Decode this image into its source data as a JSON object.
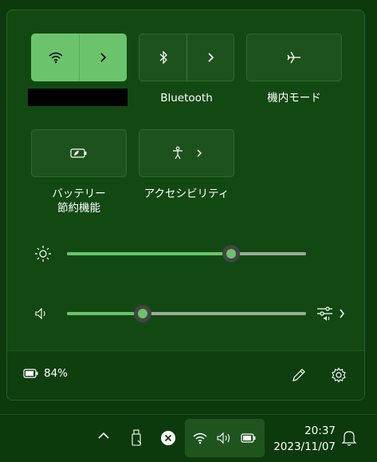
{
  "quick_settings": {
    "tiles": [
      {
        "id": "wifi",
        "label": "",
        "state": "on",
        "icon": "wifi-icon"
      },
      {
        "id": "bluetooth",
        "label": "Bluetooth",
        "state": "off",
        "icon": "bluetooth-icon"
      },
      {
        "id": "airplane",
        "label": "機内モード",
        "state": "off",
        "icon": "airplane-icon"
      },
      {
        "id": "battery_saver",
        "label_line1": "バッテリー",
        "label_line2": "節約機能",
        "state": "off",
        "icon": "battery-saver-icon"
      },
      {
        "id": "accessibility",
        "label": "アクセシビリティ",
        "state": "off",
        "icon": "accessibility-icon"
      }
    ],
    "brightness_level": 0.69,
    "volume_level": 0.31,
    "battery_text": "84%"
  },
  "taskbar": {
    "time": "20:37",
    "date": "2023/11/07"
  },
  "colors": {
    "accent": "#6bc46b",
    "panel_bg": "#124912",
    "tile_off": "#1d521d",
    "taskbar_bg": "#0c3a0c"
  }
}
